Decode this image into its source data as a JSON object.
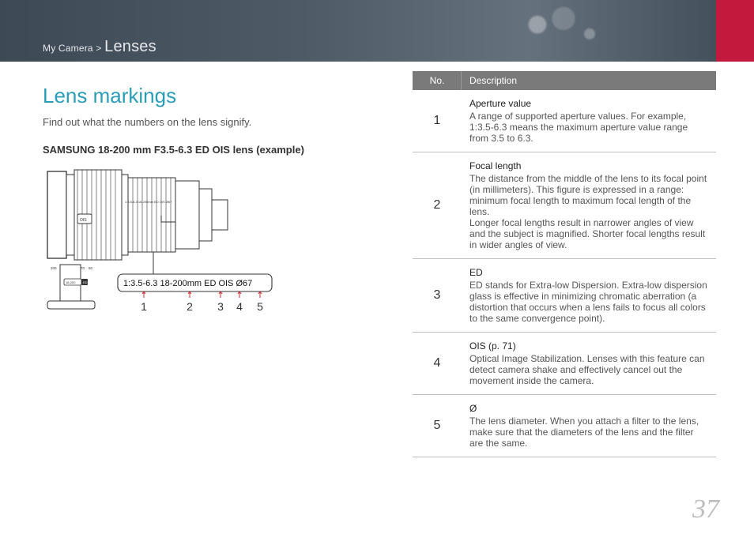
{
  "breadcrumb": {
    "section": "My Camera",
    "sep": ">",
    "topic": "Lenses"
  },
  "heading": "Lens markings",
  "intro": "Find out what the numbers on the lens signify.",
  "example_title": "SAMSUNG 18-200 mm F3.5-6.3 ED OIS lens (example)",
  "markings": {
    "text": "1:3.5-6.3  18-200mm  ED  OIS  Ø67",
    "labels": [
      "1",
      "2",
      "3",
      "4",
      "5"
    ]
  },
  "table": {
    "head": {
      "no": "No.",
      "desc": "Description"
    },
    "rows": [
      {
        "no": "1",
        "term": "Aperture value",
        "body": "A range of supported aperture values. For example, 1:3.5-6.3 means the maximum aperture value range from 3.5 to 6.3."
      },
      {
        "no": "2",
        "term": "Focal length",
        "body": "The distance from the middle of the lens to its focal point (in millimeters). This figure is expressed in a range: minimum focal length to maximum focal length of the lens.\nLonger focal lengths result in narrower angles of view and the subject is magnified. Shorter focal lengths result in wider angles of view."
      },
      {
        "no": "3",
        "term": "ED",
        "body": "ED stands for Extra-low Dispersion. Extra-low dispersion glass is effective in minimizing chromatic aberration (a distortion that occurs when a lens fails to focus all colors to the same convergence point)."
      },
      {
        "no": "4",
        "term": "OIS (p. 71)",
        "body": "Optical Image Stabilization. Lenses with this feature can detect camera shake and effectively cancel out the movement inside the camera."
      },
      {
        "no": "5",
        "term": "Ø",
        "body": "The lens diameter. When you attach a filter to the lens, make sure that the diameters of the lens and the filter are the same."
      }
    ]
  },
  "page_number": "37"
}
